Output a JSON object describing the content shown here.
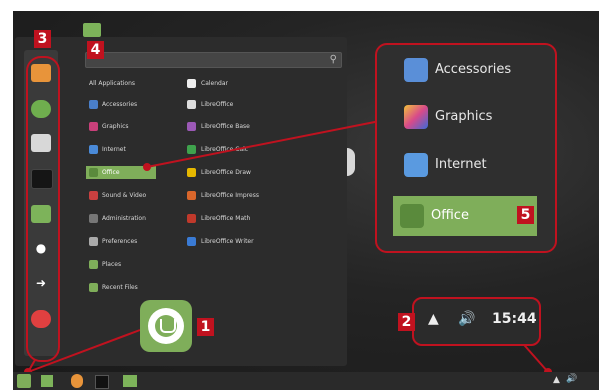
{
  "menu": {
    "search": {
      "placeholder": ""
    },
    "categories": [
      {
        "label": "All Applications",
        "icon": "none"
      },
      {
        "label": "Accessories",
        "icon": "accessories-icon",
        "color": "#4a7fc9"
      },
      {
        "label": "Graphics",
        "icon": "graphics-icon",
        "color": "#c9407a"
      },
      {
        "label": "Internet",
        "icon": "internet-icon",
        "color": "#4a8ad8"
      },
      {
        "label": "Office",
        "icon": "office-icon",
        "color": "#7fae5a"
      },
      {
        "label": "Sound & Video",
        "icon": "sound-video-icon",
        "color": "#c94040"
      },
      {
        "label": "Administration",
        "icon": "administration-icon",
        "color": "#777"
      },
      {
        "label": "Preferences",
        "icon": "preferences-icon",
        "color": "#aaa"
      },
      {
        "label": "Places",
        "icon": "places-folder-icon",
        "color": "#7fae5a"
      },
      {
        "label": "Recent Files",
        "icon": "recent-folder-icon",
        "color": "#7fae5a"
      }
    ],
    "apps": [
      {
        "label": "Calendar",
        "icon": "calendar-icon",
        "color": "#eee"
      },
      {
        "label": "LibreOffice",
        "icon": "libreoffice-icon",
        "color": "#ddd"
      },
      {
        "label": "LibreOffice Base",
        "icon": "libreoffice-base-icon",
        "color": "#9b59b6"
      },
      {
        "label": "LibreOffice Calc",
        "icon": "libreoffice-calc-icon",
        "color": "#3fa34d"
      },
      {
        "label": "LibreOffice Draw",
        "icon": "libreoffice-draw-icon",
        "color": "#e6b800"
      },
      {
        "label": "LibreOffice Impress",
        "icon": "libreoffice-impress-icon",
        "color": "#d9662b"
      },
      {
        "label": "LibreOffice Math",
        "icon": "libreoffice-math-icon",
        "color": "#c0392b"
      },
      {
        "label": "LibreOffice Writer",
        "icon": "libreoffice-writer-icon",
        "color": "#3a7bd5"
      }
    ],
    "favorites": [
      {
        "icon": "firefox-icon",
        "color": "#e8943a"
      },
      {
        "icon": "software-manager-icon",
        "color": "#6fae4e"
      },
      {
        "icon": "system-settings-icon",
        "color": "#d8d8d8"
      },
      {
        "icon": "terminal-icon",
        "color": "#151515"
      },
      {
        "icon": "files-folder-icon",
        "color": "#7db35a"
      },
      {
        "icon": "lock-screen-icon",
        "color": "#ffffff"
      },
      {
        "icon": "logout-icon",
        "color": "#ffffff"
      },
      {
        "icon": "shutdown-icon",
        "color": "#e04040"
      }
    ]
  },
  "zoom": {
    "items": [
      {
        "label": "Accessories",
        "icon": "accessories-icon",
        "color": "#5a8fd8"
      },
      {
        "label": "Graphics",
        "icon": "graphics-icon",
        "color": "#d84a8a"
      },
      {
        "label": "Internet",
        "icon": "internet-icon",
        "color": "#5a9ae0"
      },
      {
        "label": "Office",
        "icon": "office-icon",
        "color": "#7fae5a"
      }
    ]
  },
  "tray": {
    "time": "15:44",
    "network_icon": "network-icon",
    "volume_icon": "volume-icon"
  },
  "badges": {
    "b1": "1",
    "b2": "2",
    "b3": "3",
    "b4": "4",
    "b5": "5"
  },
  "colors": {
    "accent": "#c0121f",
    "mint_green": "#7fae5a",
    "highlight": "#7fae5a"
  }
}
